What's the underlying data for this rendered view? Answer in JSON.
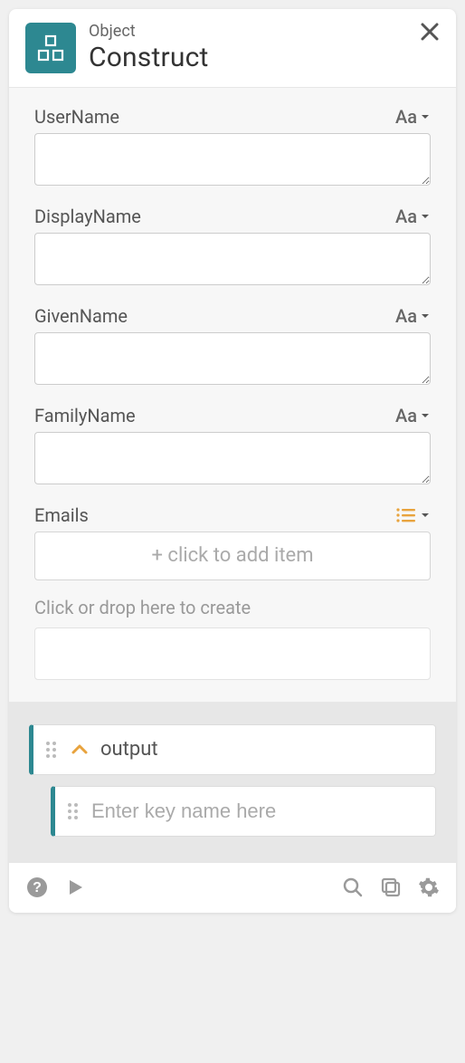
{
  "header": {
    "subtitle": "Object",
    "title": "Construct"
  },
  "fields": [
    {
      "label": "UserName",
      "type": "text",
      "value": ""
    },
    {
      "label": "DisplayName",
      "type": "text",
      "value": ""
    },
    {
      "label": "GivenName",
      "type": "text",
      "value": ""
    },
    {
      "label": "FamilyName",
      "type": "text",
      "value": ""
    }
  ],
  "emails": {
    "label": "Emails",
    "add_item_text": "+ click to add item"
  },
  "drop": {
    "label": "Click or drop here to create"
  },
  "output": {
    "label": "output",
    "key_placeholder": "Enter key name here"
  },
  "type_indicator": "Aa"
}
